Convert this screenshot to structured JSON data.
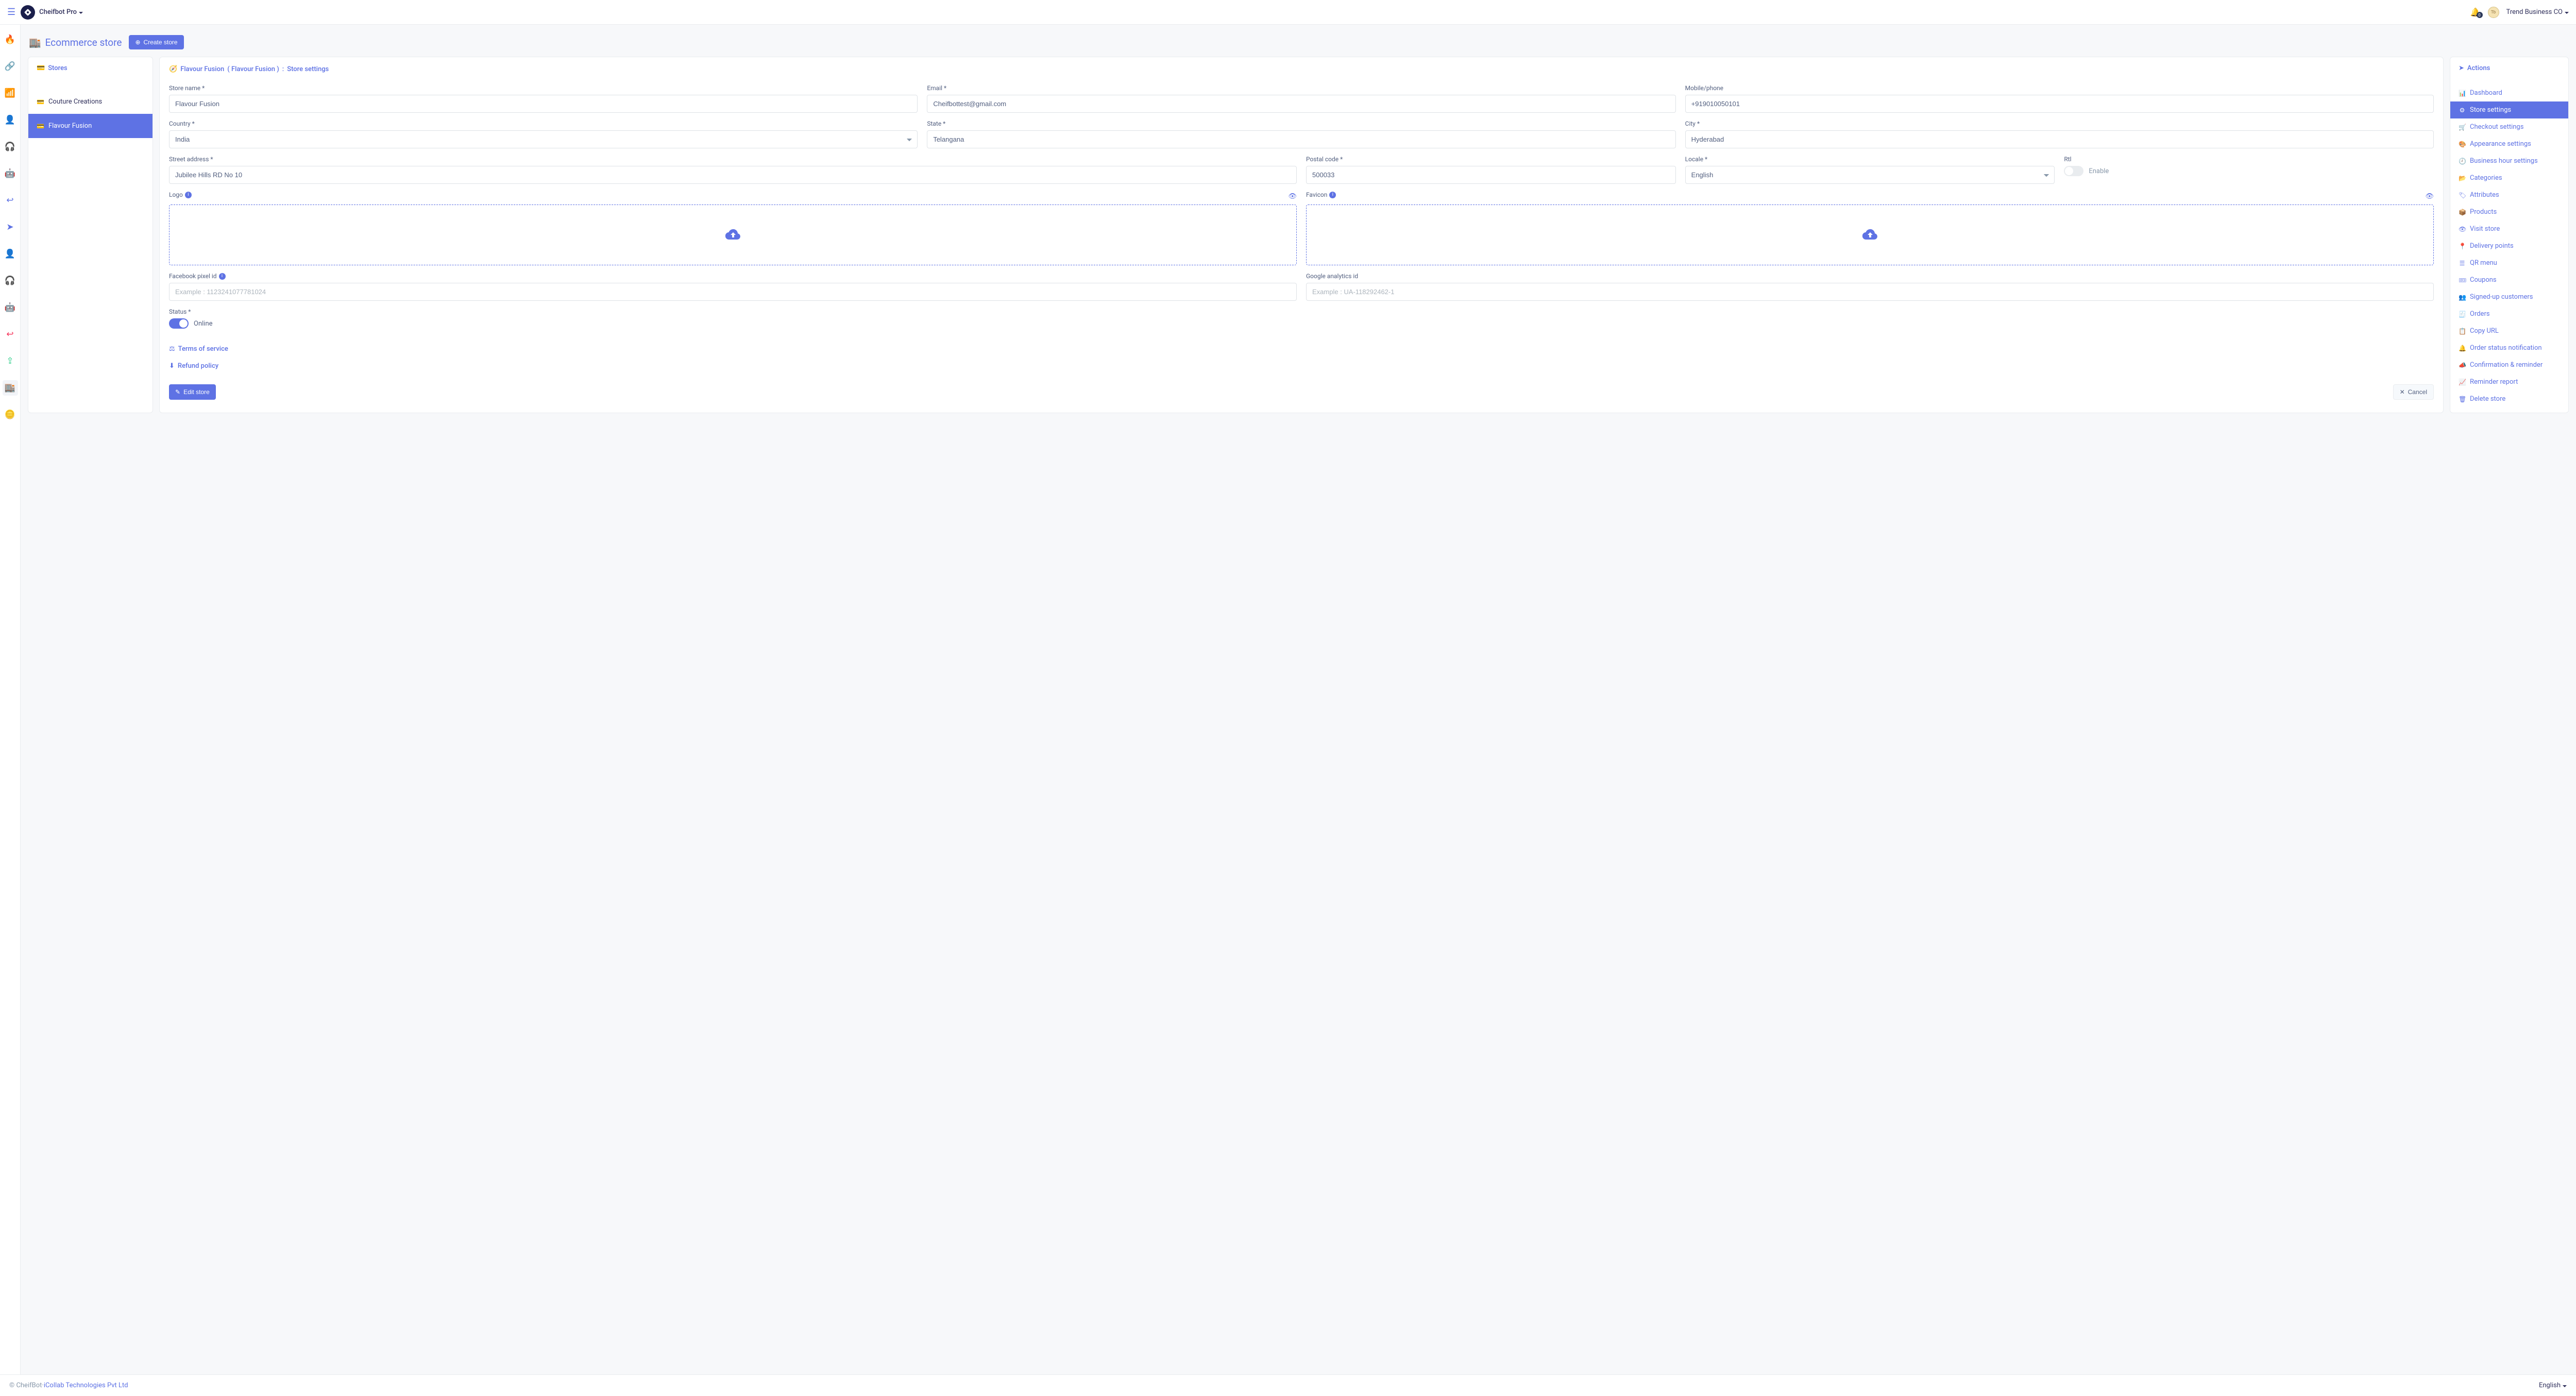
{
  "topbar": {
    "brand_name": "Cheifbot Pro",
    "account_name": "Trend Business CO",
    "notification_count": "0"
  },
  "page": {
    "title": "Ecommerce store",
    "create_button": "Create store"
  },
  "stores": {
    "header": "Stores",
    "items": [
      {
        "label": "Couture Creations",
        "active": false
      },
      {
        "label": "Flavour Fusion",
        "active": true
      }
    ]
  },
  "breadcrumb": {
    "store_name": "Flavour Fusion",
    "store_name_paren": "Flavour Fusion",
    "section": "Store settings"
  },
  "form": {
    "store_name": {
      "label": "Store name *",
      "value": "Flavour Fusion"
    },
    "email": {
      "label": "Email *",
      "value": "Cheifbottest@gmail.com"
    },
    "mobile": {
      "label": "Mobile/phone",
      "value": "+919010050101"
    },
    "country": {
      "label": "Country *",
      "value": "India"
    },
    "state": {
      "label": "State *",
      "value": "Telangana"
    },
    "city": {
      "label": "City *",
      "value": "Hyderabad"
    },
    "street": {
      "label": "Street address *",
      "value": "Jubilee Hills RD No 10"
    },
    "postal": {
      "label": "Postal code *",
      "value": "500033"
    },
    "locale": {
      "label": "Locale *",
      "value": "English"
    },
    "rtl": {
      "label": "Rtl",
      "enable_text": "Enable"
    },
    "logo": {
      "label": "Logo"
    },
    "favicon": {
      "label": "Favicon"
    },
    "fb_pixel": {
      "label": "Facebook pixel id",
      "placeholder": "Example : 1123241077781024"
    },
    "ga_id": {
      "label": "Google analytics id",
      "placeholder": "Example : UA-118292462-1"
    },
    "status": {
      "label": "Status *",
      "text": "Online"
    },
    "terms": "Terms of service",
    "refund": "Refund policy",
    "edit_btn": "Edit store",
    "cancel_btn": "Cancel"
  },
  "actions": {
    "header": "Actions",
    "items": [
      {
        "icon": "📊",
        "label": "Dashboard"
      },
      {
        "icon": "⚙",
        "label": "Store settings",
        "active": true
      },
      {
        "icon": "🛒",
        "label": "Checkout settings"
      },
      {
        "icon": "🎨",
        "label": "Appearance settings"
      },
      {
        "icon": "🕘",
        "label": "Business hour settings"
      },
      {
        "icon": "📂",
        "label": "Categories"
      },
      {
        "icon": "🏷",
        "label": "Attributes"
      },
      {
        "icon": "📦",
        "label": "Products"
      },
      {
        "icon": "👁",
        "label": "Visit store"
      },
      {
        "icon": "📍",
        "label": "Delivery points"
      },
      {
        "icon": "☰",
        "label": "QR menu"
      },
      {
        "icon": "🎟",
        "label": "Coupons"
      },
      {
        "icon": "👥",
        "label": "Signed-up customers"
      },
      {
        "icon": "🧾",
        "label": "Orders"
      },
      {
        "icon": "📋",
        "label": "Copy URL"
      },
      {
        "icon": "🔔",
        "label": "Order status notification"
      },
      {
        "icon": "📣",
        "label": "Confirmation & reminder"
      },
      {
        "icon": "📈",
        "label": "Reminder report"
      },
      {
        "icon": "🗑",
        "label": "Delete store"
      }
    ]
  },
  "footer": {
    "copyright": "© CheifBot",
    "dot": " · ",
    "company": "iCollab Technologies Pvt Ltd",
    "language": "English"
  },
  "leftnav_icons": [
    {
      "name": "flame-icon",
      "color": "red",
      "glyph": "🔥"
    },
    {
      "name": "link-icon",
      "color": "green",
      "glyph": "🔗"
    },
    {
      "name": "wifi-icon",
      "color": "blue",
      "glyph": "📶"
    },
    {
      "name": "user-icon",
      "color": "blue",
      "glyph": "👤"
    },
    {
      "name": "headset-icon",
      "color": "blue",
      "glyph": "🎧"
    },
    {
      "name": "robot-icon",
      "color": "blue",
      "glyph": "🤖"
    },
    {
      "name": "reply-icon",
      "color": "blue",
      "glyph": "↩"
    },
    {
      "name": "send-icon",
      "color": "blue",
      "glyph": "➤"
    },
    {
      "name": "user-error-icon",
      "color": "red",
      "glyph": "👤"
    },
    {
      "name": "headset-alt-icon",
      "color": "red",
      "glyph": "🎧"
    },
    {
      "name": "robot-alt-icon",
      "color": "red",
      "glyph": "🤖"
    },
    {
      "name": "reply-alt-icon",
      "color": "red",
      "glyph": "↩"
    },
    {
      "name": "export-icon",
      "color": "green",
      "glyph": "⇪"
    },
    {
      "name": "store-icon",
      "color": "red",
      "glyph": "🏬",
      "active": true
    },
    {
      "name": "coins-icon",
      "color": "yellow",
      "glyph": "🪙"
    }
  ]
}
